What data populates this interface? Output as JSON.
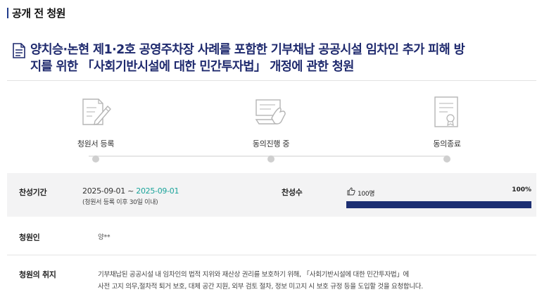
{
  "section": {
    "title": "공개 전 청원"
  },
  "petition": {
    "title_line1": "양치승·논현 제1·2호 공영주차장 사례를 포함한 기부채납 공공시설 임차인 추가 피해 방",
    "title_line2": "지를 위한 「사회기반시설에 대한 민간투자법」 개정에 관한 청원"
  },
  "steps": [
    {
      "label": "청원서 등록",
      "icon": "document-pen-icon"
    },
    {
      "label": "동의진행 중",
      "icon": "hand-keyboard-icon"
    },
    {
      "label": "동의종료",
      "icon": "certificate-icon"
    }
  ],
  "period": {
    "label": "찬성기간",
    "start": "2025-09-01",
    "separator": " ~ ",
    "end": "2025-09-01",
    "note": "(청원서 등록 이후 30일 이내)"
  },
  "support": {
    "label": "찬성수",
    "count": "100명",
    "percent_text": "100%",
    "progress": 1.0
  },
  "petitioner": {
    "label": "청원인",
    "value": "양**"
  },
  "purpose": {
    "label": "청원의 취지",
    "line1": "기부채납된 공공시설 내 임차인의 법적 지위와 재산상 권리를 보호하기 위해, 「사회기반시설에 대한 민간투자법」에",
    "line2": "사전 고지 의무,절차적 퇴거 보호, 대체 공간 지원, 외부 검토 절차, 정보 미고지 시 보호 규정 등을 도입할 것을 요청합니다."
  },
  "colors": {
    "accent": "#1d2f72",
    "title": "#1f2a6e",
    "date_end": "#1aa39a",
    "band": "#f3f3f4"
  }
}
